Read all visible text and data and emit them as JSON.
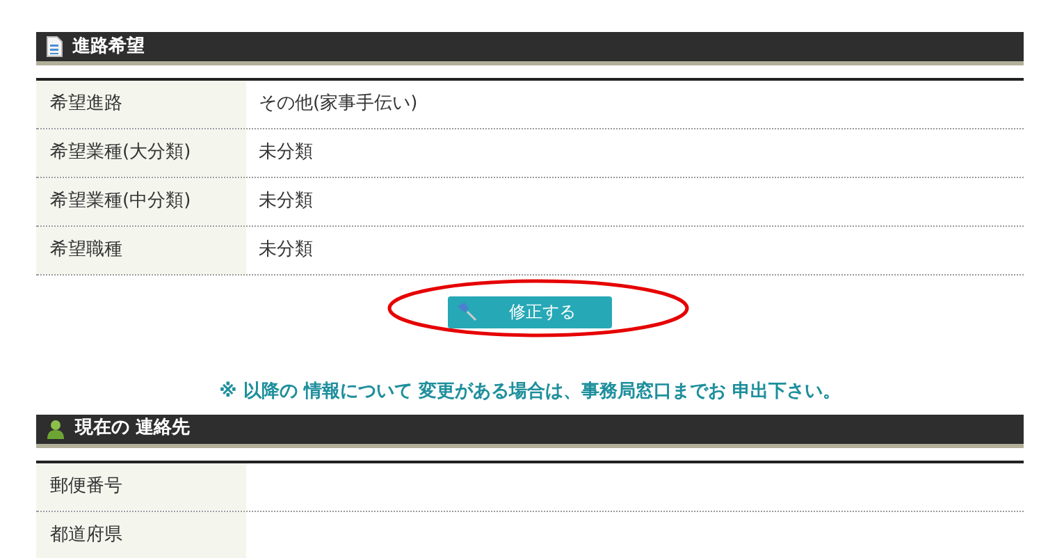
{
  "sections": [
    {
      "title": "進路希望",
      "kind": "document",
      "rows": [
        {
          "label": "希望進路",
          "value": "その他(家事手伝い)"
        },
        {
          "label": "希望業種(大分類)",
          "value": "未分類"
        },
        {
          "label": "希望業種(中分類)",
          "value": "未分類"
        },
        {
          "label": "希望職種",
          "value": "未分類"
        }
      ],
      "button": {
        "label": "修正する",
        "highlighted": true
      },
      "notice": "※ 以降の 情報について 変更がある場合は、事務局窓口までお 申出下さい。"
    },
    {
      "title": "現在の 連絡先",
      "kind": "person",
      "rows": [
        {
          "label": "郵便番号"
        },
        {
          "label": "都道府県"
        }
      ]
    }
  ]
}
